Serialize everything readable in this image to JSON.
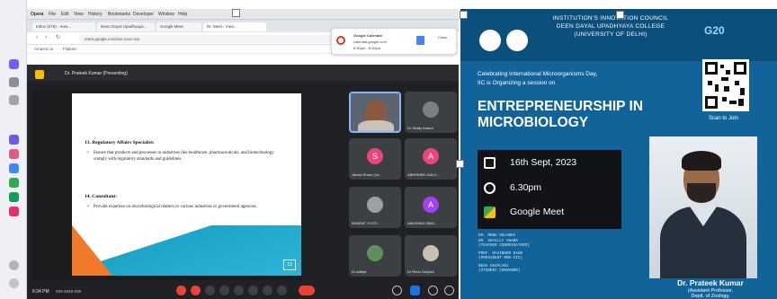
{
  "menubar": {
    "items": [
      "Opera",
      "File",
      "Edit",
      "View",
      "History",
      "Bookmarks",
      "Developer",
      "Window",
      "Help"
    ]
  },
  "tabs": [
    {
      "label": "Inbox (276) - mea..."
    },
    {
      "label": "Deen Dayal Upadhyaya..."
    },
    {
      "label": "Google Meet"
    },
    {
      "label": "Dr. Meet - mea..."
    }
  ],
  "address": {
    "url": "meet.google.com/xxx-xxxx-xxx"
  },
  "bookmarks": {
    "items": [
      "Amazon.in",
      "Flipkart"
    ]
  },
  "notification": {
    "title": "Google Calendar",
    "line1": "calendar.google.com",
    "line2": "6:30pm · 6:30pm",
    "action": "Close"
  },
  "meet": {
    "title": "Dr. Prateek Kumar (Presenting)",
    "time": "6:34 PM",
    "meeting_code": "xxx-xxxx-xxx",
    "participants": [
      {
        "name": "",
        "initial": "",
        "kind": "video"
      },
      {
        "name": "Dr Shaily Anand",
        "initial": "",
        "kind": "photo"
      },
      {
        "name": "Jahnvi Shree (Jn...",
        "initial": "S",
        "color": "#e8457a"
      },
      {
        "name": "ABHISHEK GALO...",
        "initial": "A",
        "color": "#e8457a"
      },
      {
        "name": "BHARAT JYOTI...",
        "initial": "",
        "kind": "photo"
      },
      {
        "name": "ANUSHKA SING...",
        "initial": "A",
        "color": "#a142f4"
      },
      {
        "name": "Dr Aditya",
        "initial": "",
        "kind": "photo"
      },
      {
        "name": "Dr Renu Gulyani",
        "initial": "",
        "kind": "photo"
      }
    ]
  },
  "slide": {
    "heading1": "13. Regulatory Affairs Specialist:",
    "bullet1": "Ensure that products and processes in industries like healthcare, pharmaceuticals, and biotechnology comply with regulatory standards and guidelines.",
    "heading2": "14. Consultant:",
    "bullet2": "Provide expertise on microbiological matters to various industries or government agencies.",
    "number": "13"
  },
  "poster": {
    "council_line1": "INSTITUTION'S INNOVATION COUNCIL",
    "council_line2": "DEEN DAYAL UPADHYAYA COLLEGE",
    "council_line3": "(UNIVERSITY OF DELHI)",
    "g20": "G20",
    "intro_line1": "Celebrating International Microorganisms Day,",
    "intro_line2": "IIC is Organizing a session on",
    "title_line1": "ENTREPRENEURSHIP IN",
    "title_line2": "MICROBIOLOGY",
    "scan": "Scan to Join",
    "date": "16th Sept, 2023",
    "time": "6.30pm",
    "venue": "Google Meet",
    "committee": [
      "DR. MONU SOLANKI",
      "DR. SHAILLY ANAND",
      "(TEACHER COORDINATORS)",
      "PROF. RAVINDER KAUR",
      "(PRESIDENT MOE-IIC)",
      "NEHA GHIPLANI",
      "(STUDENT CONVENOR)"
    ],
    "speaker": "Dr. Prateek Kumar",
    "role_line1": "(Assistant Professor,",
    "role_line2": "Deptt. of Zoology,"
  }
}
